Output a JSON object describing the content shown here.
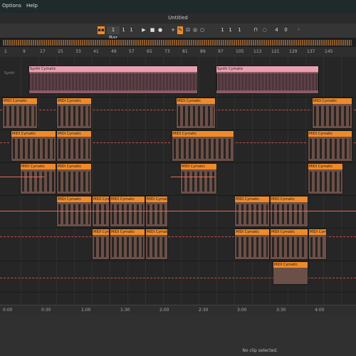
{
  "menu": {
    "options": "Options",
    "help": "Help"
  },
  "window": {
    "title": "Untitled"
  },
  "transport": {
    "quantize": "1 Bar",
    "pos_bar": "1",
    "pos_beat": "1",
    "loop_start": "1",
    "loop_length": "1",
    "loop_end": "1",
    "time_sig": "4",
    "time_sig_den": "0"
  },
  "ruler_marks": [
    "1",
    "9",
    "17",
    "25",
    "33",
    "41",
    "49",
    "57",
    "65",
    "73",
    "81",
    "89",
    "97",
    "105",
    "113",
    "121",
    "129",
    "137",
    "145"
  ],
  "time_marks": [
    "0:00",
    "0:30",
    "1:00",
    "1:30",
    "2:00",
    "2:30",
    "3:00",
    "3:30",
    "4:00"
  ],
  "track_labels": [
    "Synth",
    "MIDI Cym",
    "MIDI Cym",
    "MIDI Cym",
    "MIDI Cym",
    "MIDI Cym",
    "MIDI Cym"
  ],
  "clip_labels": {
    "audio": "Synth Cymatic",
    "midi": "MIDI Cymatic"
  },
  "status": {
    "text": "No clip selected."
  },
  "colors": {
    "clip_orange": "#f08a28",
    "clip_pink": "#e8a0b0",
    "automation": "#e06a55"
  }
}
